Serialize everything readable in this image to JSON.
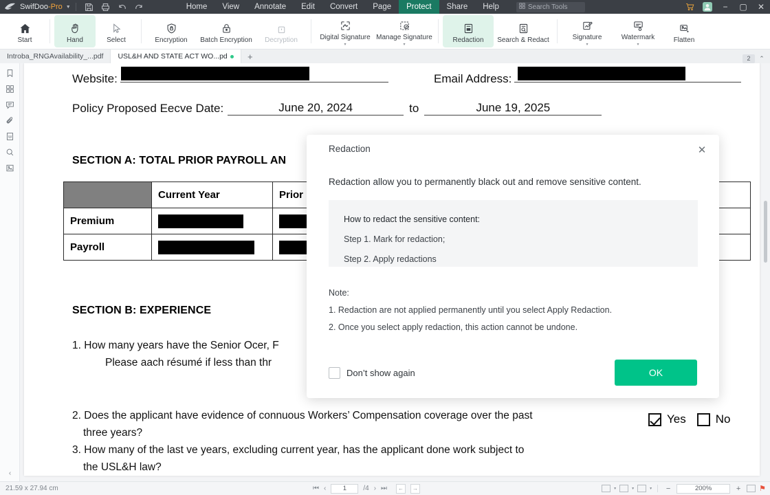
{
  "titlebar": {
    "app_name": "SwifDoo",
    "app_suffix": "-Pro",
    "quick_actions": [
      {
        "name": "save-icon",
        "label": "Save"
      },
      {
        "name": "print-icon",
        "label": "Print"
      },
      {
        "name": "undo-icon",
        "label": "Undo"
      },
      {
        "name": "redo-icon",
        "label": "Redo"
      }
    ],
    "menus": [
      {
        "label": "Home",
        "active": false
      },
      {
        "label": "View",
        "active": false
      },
      {
        "label": "Annotate",
        "active": false
      },
      {
        "label": "Edit",
        "active": false
      },
      {
        "label": "Convert",
        "active": false
      },
      {
        "label": "Page",
        "active": false
      },
      {
        "label": "Protect",
        "active": true
      },
      {
        "label": "Share",
        "active": false
      },
      {
        "label": "Help",
        "active": false
      }
    ],
    "search_placeholder": "Search Tools",
    "window_buttons": [
      "minimize",
      "maximize",
      "close"
    ],
    "active_menu_color": "#1a7a62"
  },
  "ribbon": {
    "items": [
      {
        "label": "Start",
        "icon": "home-icon",
        "state": "normal",
        "arrow": false
      },
      {
        "label": "Hand",
        "icon": "hand-icon",
        "state": "selected",
        "arrow": false
      },
      {
        "label": "Select",
        "icon": "cursor-icon",
        "state": "normal",
        "arrow": false
      },
      {
        "label": "Encryption",
        "icon": "shield-lock-icon",
        "state": "normal",
        "arrow": false
      },
      {
        "label": "Batch Encryption",
        "icon": "padlock-icon",
        "state": "normal",
        "arrow": false
      },
      {
        "label": "Decryption",
        "icon": "unlock-icon",
        "state": "disabled",
        "arrow": false
      },
      {
        "label": "Digital Signature",
        "icon": "digital-signature-icon",
        "state": "normal",
        "arrow": true
      },
      {
        "label": "Manage Signature",
        "icon": "manage-signature-icon",
        "state": "normal",
        "arrow": true
      },
      {
        "label": "Redaction",
        "icon": "redaction-icon",
        "state": "selected",
        "arrow": false
      },
      {
        "label": "Search & Redact",
        "icon": "search-redact-icon",
        "state": "normal",
        "arrow": false
      },
      {
        "label": "Signature",
        "icon": "signature-icon",
        "state": "normal",
        "arrow": true
      },
      {
        "label": "Watermark",
        "icon": "watermark-icon",
        "state": "normal",
        "arrow": true
      },
      {
        "label": "Flatten",
        "icon": "flatten-icon",
        "state": "normal",
        "arrow": false
      }
    ],
    "selected_bg": "#dff3ea"
  },
  "tabbar": {
    "tabs": [
      {
        "label": "Introba_RNGAvailability_...pdf",
        "active": false,
        "modified": false
      },
      {
        "label": "USL&H AND STATE ACT WO...pd",
        "active": true,
        "modified": true
      }
    ],
    "add_tab_label": "+",
    "page_badge": "2"
  },
  "rail": {
    "items": [
      {
        "name": "bookmark-icon",
        "label": "Bookmarks"
      },
      {
        "name": "thumbnails-icon",
        "label": "Thumbnails"
      },
      {
        "name": "comment-icon",
        "label": "Comments"
      },
      {
        "name": "attachment-icon",
        "label": "Attachments"
      },
      {
        "name": "word-icon",
        "label": "Word Converter"
      },
      {
        "name": "search-icon",
        "label": "Search"
      },
      {
        "name": "image-extract-icon",
        "label": "Extract Image"
      }
    ],
    "collapse_label": "‹"
  },
  "document": {
    "fields": [
      {
        "label": "Website:",
        "value": "",
        "redacted": true
      },
      {
        "label": "Email Address:",
        "value": "",
        "redacted": true
      }
    ],
    "policy_label": "Policy Proposed Eecve Date:",
    "policy_start": "June 20, 2024",
    "policy_join": "to",
    "policy_end": "June 19, 2025",
    "section_a_title": "SECTION A: TOTAL PRIOR PAYROLL AN",
    "table": {
      "headers": [
        "",
        "Current Year",
        "Prior "
      ],
      "rows": [
        {
          "label": "Premium",
          "current_year": "",
          "prior_year": "",
          "redacted": true
        },
        {
          "label": "Payroll",
          "current_year": "",
          "prior_year": "",
          "redacted": true
        }
      ]
    },
    "section_b_title": "SECTION B: EXPERIENCE",
    "questions": [
      {
        "number": "1.",
        "line1": "How many years have the Senior Ocer, F",
        "line2": "Please aach résumé if less than thr"
      },
      {
        "number": "2.",
        "line1": "Does the applicant have evidence of connuous Workers’ Compensation coverage over the past",
        "line2": "three years?",
        "answers": [
          {
            "label": "Yes",
            "checked": true
          },
          {
            "label": "No",
            "checked": false
          }
        ]
      },
      {
        "number": "3.",
        "line1": "How many of the last ve years, excluding current year, has the applicant done work subject to",
        "line2": "the USL&H law?"
      }
    ]
  },
  "modal": {
    "title": "Redaction",
    "close_label": "✕",
    "description": "Redaction allow you to permanently black out and remove sensitive content.",
    "steps_heading": "How to redact the sensitive content:",
    "steps": [
      "Step 1. Mark for redaction;",
      "Step 2. Apply redactions"
    ],
    "note_heading": "Note:",
    "notes": [
      "1. Redaction are not applied permanently until you select Apply Redaction.",
      "2. Once you select apply redaction, this action cannot be undone."
    ],
    "dont_show_label": "Don’t show again",
    "dont_show_checked": false,
    "ok_label": "OK",
    "ok_color": "#00c389"
  },
  "statusbar": {
    "page_size": "21.59 x 27.94 cm",
    "first_label": "⏮",
    "prev_label": "‹",
    "page_current": "1",
    "page_total": "/4",
    "next_label": "›",
    "last_label": "⏭",
    "back_label": "←",
    "forward_label": "→",
    "view_modes": [
      "grid-view-icon",
      "single-page-icon",
      "continuous-icon"
    ],
    "zoom_out": "−",
    "zoom_level": "200%",
    "zoom_in": "+",
    "fit_icon": "fit-page-icon",
    "pin_icon": "pin-icon"
  }
}
